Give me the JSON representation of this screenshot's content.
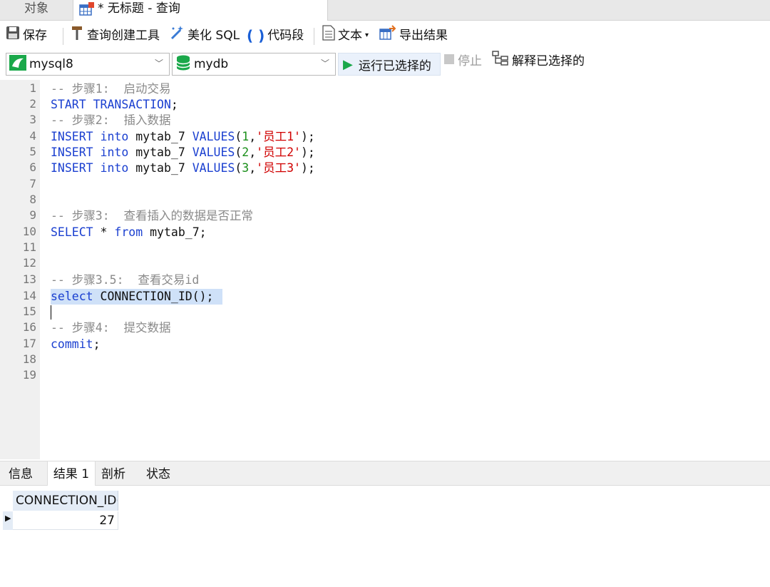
{
  "tabs": {
    "objects": "对象",
    "query_title": "* 无标题 - 查询"
  },
  "toolbar": {
    "save": "保存",
    "query_builder": "查询创建工具",
    "beautify": "美化 SQL",
    "snippet": "代码段",
    "text": "文本",
    "export": "导出结果"
  },
  "connection": {
    "server": "mysql8",
    "database": "mydb",
    "run": "运行已选择的",
    "stop": "停止",
    "explain": "解释已选择的"
  },
  "editor": {
    "line_numbers": [
      "1",
      "2",
      "3",
      "4",
      "5",
      "6",
      "7",
      "8",
      "9",
      "10",
      "11",
      "12",
      "13",
      "14",
      "15",
      "16",
      "17",
      "18",
      "19"
    ],
    "lines": {
      "l1": "-- 步骤1:  启动交易",
      "l2_kw": "START TRANSACTION",
      "l2_rest": ";",
      "l3": "-- 步骤2:  插入数据",
      "insert_kw1": "INSERT",
      "insert_kw2": "into",
      "insert_table": "mytab_7",
      "insert_kw3": "VALUES",
      "row4": {
        "id": "1",
        "name": "'员工1'"
      },
      "row5": {
        "id": "2",
        "name": "'员工2'"
      },
      "row6": {
        "id": "3",
        "name": "'员工3'"
      },
      "l9": "-- 步骤3:  查看插入的数据是否正常",
      "l10_kw1": "SELECT",
      "l10_star": "*",
      "l10_kw2": "from",
      "l10_rest": "mytab_7;",
      "l13": "-- 步骤3.5:  查看交易id",
      "l14_kw": "select",
      "l14_rest": "CONNECTION_ID();",
      "l16": "-- 步骤4:  提交数据",
      "l17_kw": "commit",
      "l17_rest": ";"
    }
  },
  "results": {
    "tabs": [
      "信息",
      "结果 1",
      "剖析",
      "状态"
    ],
    "column": "CONNECTION_ID()",
    "value": "27"
  },
  "colors": {
    "keyword": "#1a3fd0",
    "comment": "#8a8a8a",
    "number": "#1a8f1a",
    "string": "#d00000",
    "selection": "#cfe1f8"
  }
}
